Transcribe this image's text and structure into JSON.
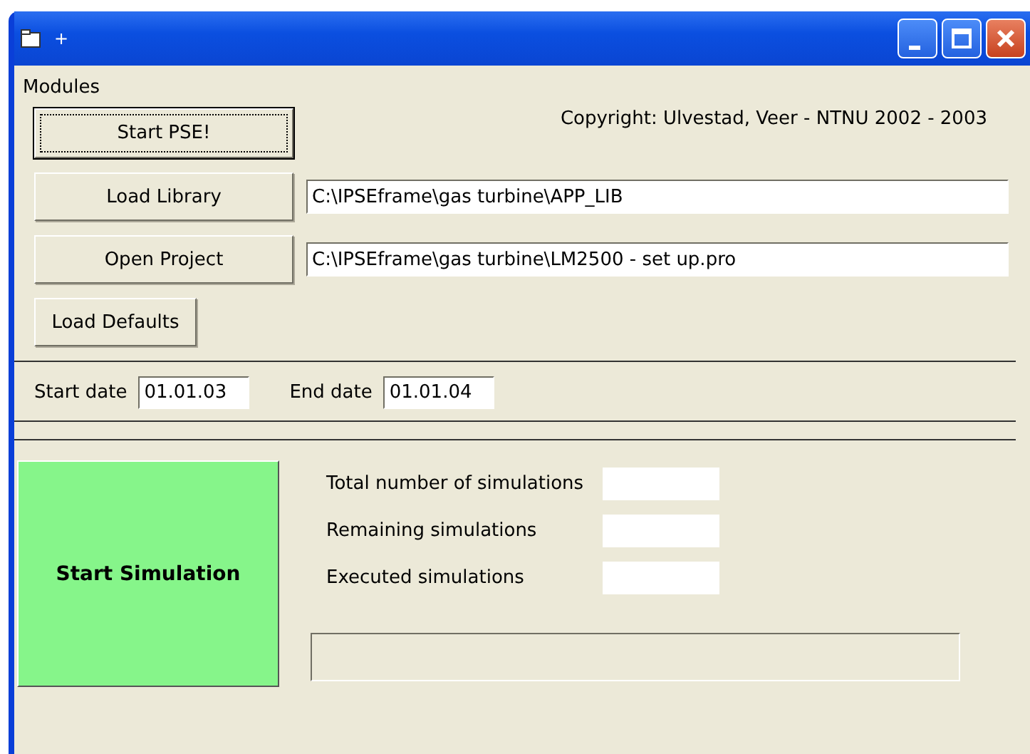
{
  "window": {
    "title": "+"
  },
  "menu": [
    {
      "label": "Modules"
    }
  ],
  "copyright": "Copyright: Ulvestad, Veer - NTNU 2002 - 2003",
  "start_pse": {
    "label": "Start PSE!",
    "focused": true
  },
  "paths": [
    {
      "button": "Load Library",
      "value": "C:\\IPSEframe\\gas turbine\\APP_LIB"
    },
    {
      "button": "Open Project",
      "value": "C:\\IPSEframe\\gas turbine\\LM2500 - set up.pro"
    }
  ],
  "load_defaults": "Load Defaults",
  "dates": [
    {
      "label": "Start date",
      "value": "01.01.03"
    },
    {
      "label": "End date",
      "value": "01.01.04"
    }
  ],
  "simulation": {
    "button": "Start Simulation",
    "counters": [
      {
        "label": "Total number of simulations"
      },
      {
        "label": "Remaining simulations"
      },
      {
        "label": "Executed simulations"
      }
    ]
  }
}
